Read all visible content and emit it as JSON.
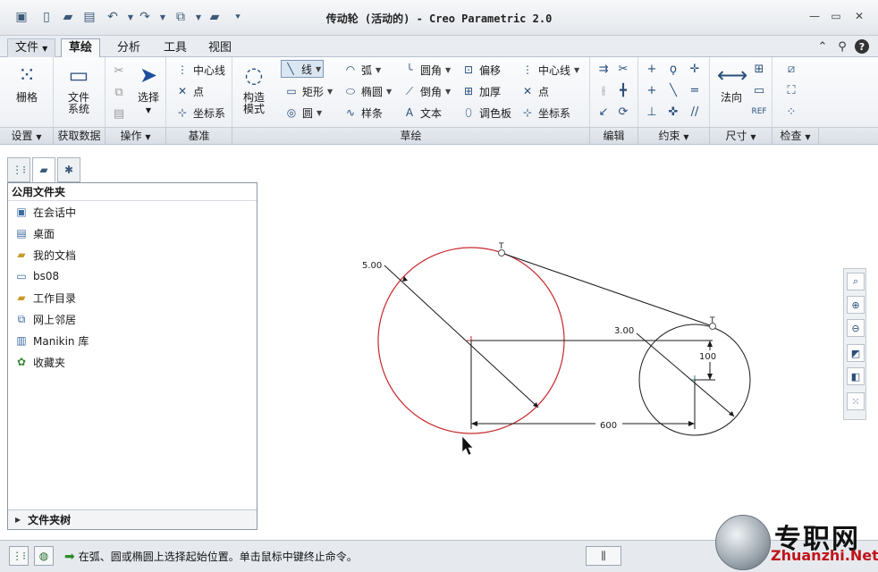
{
  "window": {
    "title": "传动轮 (活动的) - Creo Parametric 2.0"
  },
  "ribbon_tabs": [
    {
      "label": "文件"
    },
    {
      "label": "草绘"
    },
    {
      "label": "分析"
    },
    {
      "label": "工具"
    },
    {
      "label": "视图"
    }
  ],
  "ribbon": {
    "grid": "栅格",
    "file_system_l1": "文件",
    "file_system_l2": "系统",
    "select": "选择",
    "centerline": "中心线",
    "point": "点",
    "csys": "坐标系",
    "construction_l1": "构造",
    "construction_l2": "模式",
    "line": "线",
    "rectangle": "矩形",
    "circle": "圆",
    "arc": "弧",
    "ellipse": "椭圆",
    "spline": "样条",
    "fillet": "圆角",
    "chamfer": "倒角",
    "text": "文本",
    "offset": "偏移",
    "thicken": "加厚",
    "palette": "调色板",
    "centerline2": "中心线",
    "point2": "点",
    "csys2": "坐标系",
    "normal": "法向"
  },
  "groups": {
    "setup": "设置",
    "get_data": "获取数据",
    "operations": "操作",
    "datum": "基准",
    "sketching": "草绘",
    "editing": "编辑",
    "constrain": "约束",
    "dimension": "尺寸",
    "inspect": "检查"
  },
  "navigator": {
    "header": "公用文件夹",
    "items": [
      {
        "label": "在会话中",
        "icon": "monitor-icon"
      },
      {
        "label": "桌面",
        "icon": "desktop-icon"
      },
      {
        "label": "我的文档",
        "icon": "documents-icon"
      },
      {
        "label": "bs08",
        "icon": "computer-icon"
      },
      {
        "label": "工作目录",
        "icon": "working-dir-icon"
      },
      {
        "label": "网上邻居",
        "icon": "network-icon"
      },
      {
        "label": "Manikin 库",
        "icon": "library-icon"
      },
      {
        "label": "收藏夹",
        "icon": "favorites-icon"
      }
    ],
    "folder_tree": "文件夹树"
  },
  "sketch": {
    "dim_big_circle": "5.00",
    "dim_small_circle": "3.00",
    "dim_vertical": "100",
    "dim_horizontal": "600",
    "big_circle_color": "#c8282d",
    "line_color": "#1a1a1a"
  },
  "status": {
    "message": "在弧、圆或椭圆上选择起始位置。单击鼠标中键终止命令。"
  },
  "watermark": {
    "cn": "专职网",
    "url": "Zhuanzhi.Net"
  }
}
